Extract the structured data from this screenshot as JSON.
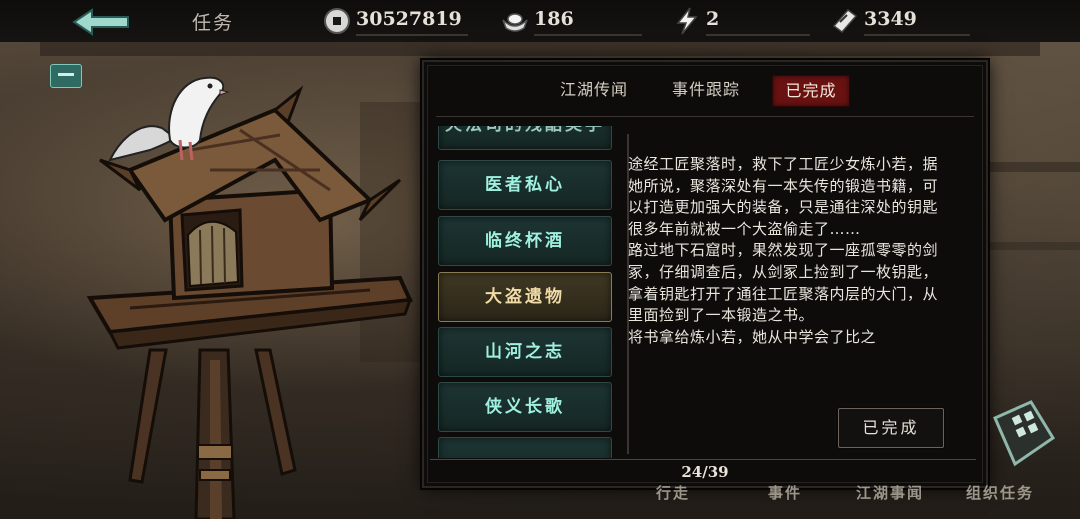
{
  "header": {
    "title": "任务",
    "resources": [
      {
        "name": "copper-coin",
        "value": "30527819"
      },
      {
        "name": "silver-ingot",
        "value": "186"
      },
      {
        "name": "energy",
        "value": "2"
      },
      {
        "name": "ticket",
        "value": "3349"
      }
    ]
  },
  "tabs": [
    {
      "label": "江湖传闻",
      "active": false
    },
    {
      "label": "事件跟踪",
      "active": false
    },
    {
      "label": "已完成",
      "active": true
    }
  ],
  "quests": [
    {
      "label": "火法司的残酷美学",
      "state": "partial"
    },
    {
      "label": "医者私心",
      "state": "normal"
    },
    {
      "label": "临终杯酒",
      "state": "normal"
    },
    {
      "label": "大盗遗物",
      "state": "selected"
    },
    {
      "label": "山河之志",
      "state": "normal"
    },
    {
      "label": "侠义长歌",
      "state": "normal"
    }
  ],
  "description": {
    "paragraph1": "途经工匠聚落时，救下了工匠少女炼小若，据她所说，聚落深处有一本失传的锻造书籍，可以打造更加强大的装备，只是通往深处的钥匙很多年前就被一个大盗偷走了……",
    "paragraph2": "路过地下石窟时，果然发现了一座孤零零的剑冢，仔细调查后，从剑冢上捡到了一枚钥匙，拿着钥匙打开了通往工匠聚落内层的大门，从里面捡到了一本锻造之书。",
    "paragraph3": "将书拿给炼小若，她从中学会了比之"
  },
  "status_button": "已完成",
  "pagination": "24/39",
  "bottom_nav": [
    "行走",
    "事件",
    "江湖事闻",
    "组织任务"
  ],
  "colors": {
    "active_tab": "#6a1212",
    "quest_text": "#9ff0df",
    "selected_quest_text": "#f0dba8"
  }
}
